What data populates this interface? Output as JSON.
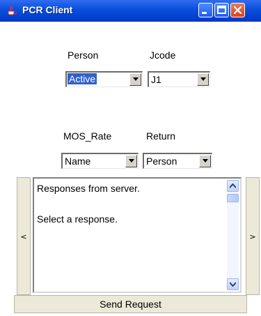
{
  "window": {
    "title": "PCR Client"
  },
  "icons": {
    "app": "java-cup-icon",
    "minimize": "minimize-icon",
    "maximize": "maximize-icon",
    "close": "close-icon"
  },
  "form": {
    "person_label": "Person",
    "person_value": "Active",
    "jcode_label": "Jcode",
    "jcode_value": "J1",
    "mos_rate_label": "MOS_Rate",
    "mos_rate_value": "Name",
    "return_label": "Return",
    "return_value": "Person"
  },
  "responses": {
    "line1": "Responses from server.",
    "line2": "Select a response."
  },
  "nav": {
    "prev_label": "<",
    "next_label": ">"
  },
  "actions": {
    "send_label": "Send Request"
  },
  "colors": {
    "titlebar": "#0a4fdc",
    "selection": "#2f5fd0",
    "close": "#d9421c"
  }
}
